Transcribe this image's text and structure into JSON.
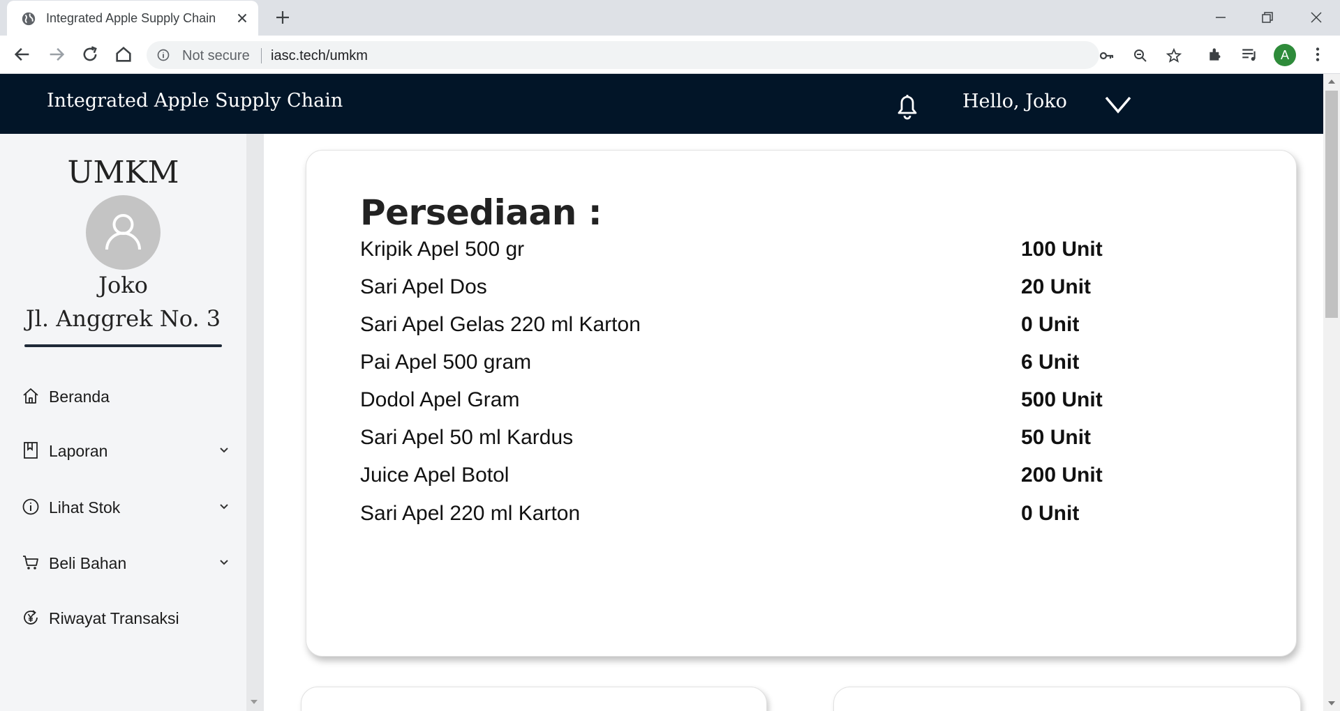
{
  "browser": {
    "tab_title": "Integrated Apple Supply Chain",
    "security_label": "Not secure",
    "url": "iasc.tech/umkm",
    "profile_initial": "A",
    "profile_color": "#2e8b3a"
  },
  "header": {
    "brand": "Integrated Apple Supply Chain",
    "greeting": "Hello, Joko",
    "background": "#021528"
  },
  "sidebar": {
    "role": "UMKM",
    "name": "Joko",
    "address": "Jl. Anggrek No. 3",
    "menu": [
      {
        "label": "Beranda",
        "icon": "home-icon",
        "has_submenu": false
      },
      {
        "label": "Laporan",
        "icon": "bookmark-icon",
        "has_submenu": true
      },
      {
        "label": "Lihat Stok",
        "icon": "info-icon",
        "has_submenu": true
      },
      {
        "label": "Beli Bahan",
        "icon": "cart-icon",
        "has_submenu": true
      },
      {
        "label": "Riwayat Transaksi",
        "icon": "yen-history-icon",
        "has_submenu": false
      }
    ]
  },
  "inventory": {
    "title": "Persediaan :",
    "items": [
      {
        "name": "Kripik Apel 500 gr",
        "qty": "100 Unit"
      },
      {
        "name": "Sari Apel Dos",
        "qty": "20 Unit"
      },
      {
        "name": "Sari Apel Gelas 220 ml Karton",
        "qty": "0 Unit"
      },
      {
        "name": "Pai Apel 500 gram",
        "qty": "6 Unit"
      },
      {
        "name": "Dodol Apel Gram",
        "qty": "500 Unit"
      },
      {
        "name": "Sari Apel 50 ml Kardus",
        "qty": "50 Unit"
      },
      {
        "name": "Juice Apel Botol",
        "qty": "200 Unit"
      },
      {
        "name": "Sari Apel 220 ml Karton",
        "qty": "0 Unit"
      }
    ]
  }
}
